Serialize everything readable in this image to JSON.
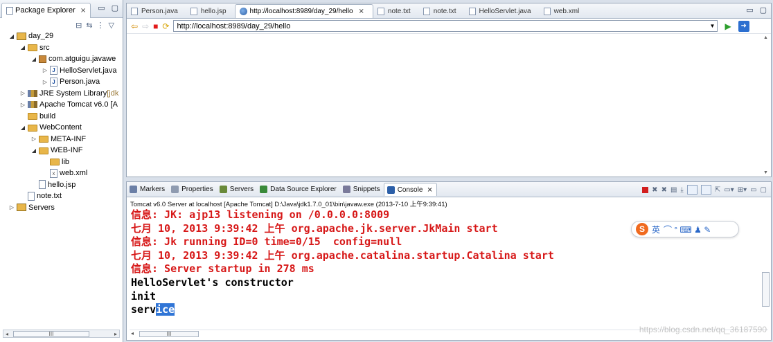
{
  "package_explorer": {
    "title": "Package Explorer",
    "close_glyph": "⨯",
    "tree": [
      {
        "label": "day_29",
        "suffix": "",
        "icon": "project-icon",
        "twisty": "◢",
        "depth": 0
      },
      {
        "label": "src",
        "suffix": "",
        "icon": "source-folder-icon",
        "twisty": "◢",
        "depth": 1
      },
      {
        "label": "com.atguigu.javawe",
        "suffix": "",
        "icon": "package-icon",
        "twisty": "◢",
        "depth": 2
      },
      {
        "label": "HelloServlet.java",
        "suffix": "",
        "icon": "java-file-icon",
        "twisty": "▷",
        "depth": 3
      },
      {
        "label": "Person.java",
        "suffix": "",
        "icon": "java-file-icon",
        "twisty": "▷",
        "depth": 3
      },
      {
        "label": "JRE System Library ",
        "suffix": "[jdk",
        "icon": "library-icon",
        "twisty": "▷",
        "depth": 1
      },
      {
        "label": "Apache Tomcat v6.0 [A",
        "suffix": "",
        "icon": "library-icon",
        "twisty": "▷",
        "depth": 1
      },
      {
        "label": "build",
        "suffix": "",
        "icon": "folder-icon",
        "twisty": "",
        "depth": 1
      },
      {
        "label": "WebContent",
        "suffix": "",
        "icon": "folder-icon",
        "twisty": "◢",
        "depth": 1
      },
      {
        "label": "META-INF",
        "suffix": "",
        "icon": "folder-icon",
        "twisty": "▷",
        "depth": 2
      },
      {
        "label": "WEB-INF",
        "suffix": "",
        "icon": "folder-icon",
        "twisty": "◢",
        "depth": 2
      },
      {
        "label": "lib",
        "suffix": "",
        "icon": "folder-icon",
        "twisty": "",
        "depth": 3
      },
      {
        "label": "web.xml",
        "suffix": "",
        "icon": "xml-file-icon",
        "twisty": "",
        "depth": 3
      },
      {
        "label": "hello.jsp",
        "suffix": "",
        "icon": "file-icon",
        "twisty": "",
        "depth": 2
      },
      {
        "label": "note.txt",
        "suffix": "",
        "icon": "file-icon",
        "twisty": "",
        "depth": 1
      },
      {
        "label": "Servers",
        "suffix": "",
        "icon": "project-icon",
        "twisty": "▷",
        "depth": 0
      }
    ],
    "scroll_glyph": "III"
  },
  "editor": {
    "tabs": [
      {
        "label": "Person.java",
        "active": false
      },
      {
        "label": "hello.jsp",
        "active": false
      },
      {
        "label": "http://localhost:8989/day_29/hello",
        "active": true
      },
      {
        "label": "note.txt",
        "active": false
      },
      {
        "label": "note.txt",
        "active": false
      },
      {
        "label": "HelloServlet.java",
        "active": false
      },
      {
        "label": "web.xml",
        "active": false
      }
    ],
    "close_glyph": "⨯",
    "url": "http://localhost:8989/day_29/hello"
  },
  "console": {
    "tabs": [
      {
        "label": "Markers",
        "color": "#6b7fa6",
        "active": false
      },
      {
        "label": "Properties",
        "color": "#8f9bb0",
        "active": false
      },
      {
        "label": "Servers",
        "color": "#6a8a3a",
        "active": false
      },
      {
        "label": "Data Source Explorer",
        "color": "#3a8a3a",
        "active": false
      },
      {
        "label": "Snippets",
        "color": "#7a7a9a",
        "active": false
      },
      {
        "label": "Console",
        "color": "#2c5fa8",
        "active": true
      }
    ],
    "close_glyph": "⨯",
    "description": "Tomcat v6.0 Server at localhost [Apache Tomcat] D:\\Java\\jdk1.7.0_01\\bin\\javaw.exe (2013-7-10 上午9:39:41)",
    "lines": [
      {
        "text": "信息: JK: ajp13 listening on /0.0.0.0:8009",
        "kind": "err"
      },
      {
        "text": "七月 10, 2013 9:39:42 上午 org.apache.jk.server.JkMain start",
        "kind": "err"
      },
      {
        "text": "信息: Jk running ID=0 time=0/15  config=null",
        "kind": "err"
      },
      {
        "text": "七月 10, 2013 9:39:42 上午 org.apache.catalina.startup.Catalina start",
        "kind": "err"
      },
      {
        "text": "信息: Server startup in 278 ms",
        "kind": "err"
      },
      {
        "text": "HelloServlet's constructor",
        "kind": "out"
      },
      {
        "text": "init",
        "kind": "out"
      }
    ],
    "last_line": {
      "plain": "serv",
      "selected": "ice"
    },
    "ime": {
      "logo": "S",
      "mode": "英",
      "tools": "⌒ ° ⌨ ♟ ✎"
    },
    "scroll_glyph": "III",
    "watermark": "https://blog.csdn.net/qq_36187590"
  },
  "colors": {
    "stderr": "#d71818",
    "stdout": "#000000",
    "selection": "#3075d6"
  }
}
